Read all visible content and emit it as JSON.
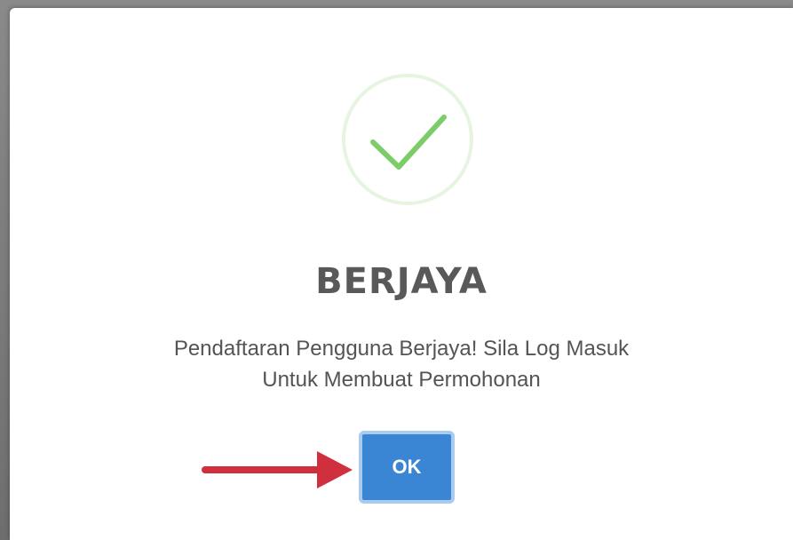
{
  "dialog": {
    "title": "BERJAYA",
    "message_line1": "Pendaftaran Pengguna Berjaya! Sila Log Masuk",
    "message_line2": "Untuk Membuat Permohonan",
    "ok_label": "OK"
  },
  "icons": {
    "success": "check-circle-icon",
    "annotation": "arrow-right-icon"
  },
  "colors": {
    "success_green": "#7ccd6a",
    "success_ring": "#e3f4dd",
    "button_blue": "#3a86d4",
    "button_focus_ring": "#a9cbee",
    "annotation_red": "#d0303e",
    "title_text": "#595959"
  }
}
